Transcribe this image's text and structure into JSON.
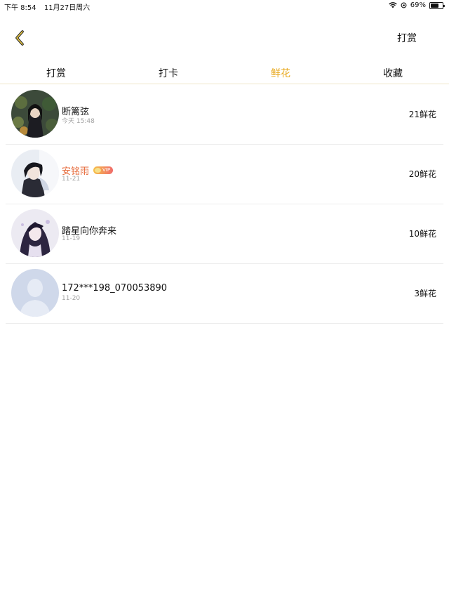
{
  "status_bar": {
    "time": "下午 8:54",
    "date": "11月27日周六",
    "battery_text": "69%",
    "battery_level": 0.69
  },
  "nav": {
    "action_label": "打赏"
  },
  "tabs": [
    {
      "label": "打赏",
      "active": false
    },
    {
      "label": "打卡",
      "active": false
    },
    {
      "label": "鲜花",
      "active": true
    },
    {
      "label": "收藏",
      "active": false
    }
  ],
  "list": [
    {
      "name": "断篱弦",
      "time": "今天 15:48",
      "count": "21鲜花",
      "vip": false
    },
    {
      "name": "安铭雨",
      "time": "11-21",
      "count": "20鲜花",
      "vip": true,
      "vip_label": "VIP"
    },
    {
      "name": "踏星向你奔来",
      "time": "11-19",
      "count": "10鲜花",
      "vip": false
    },
    {
      "name": "172***198_070053890",
      "time": "11-20",
      "count": "3鲜花",
      "vip": false
    }
  ],
  "colors": {
    "accent": "#e8a91f",
    "vip_name": "#e66a3a"
  }
}
